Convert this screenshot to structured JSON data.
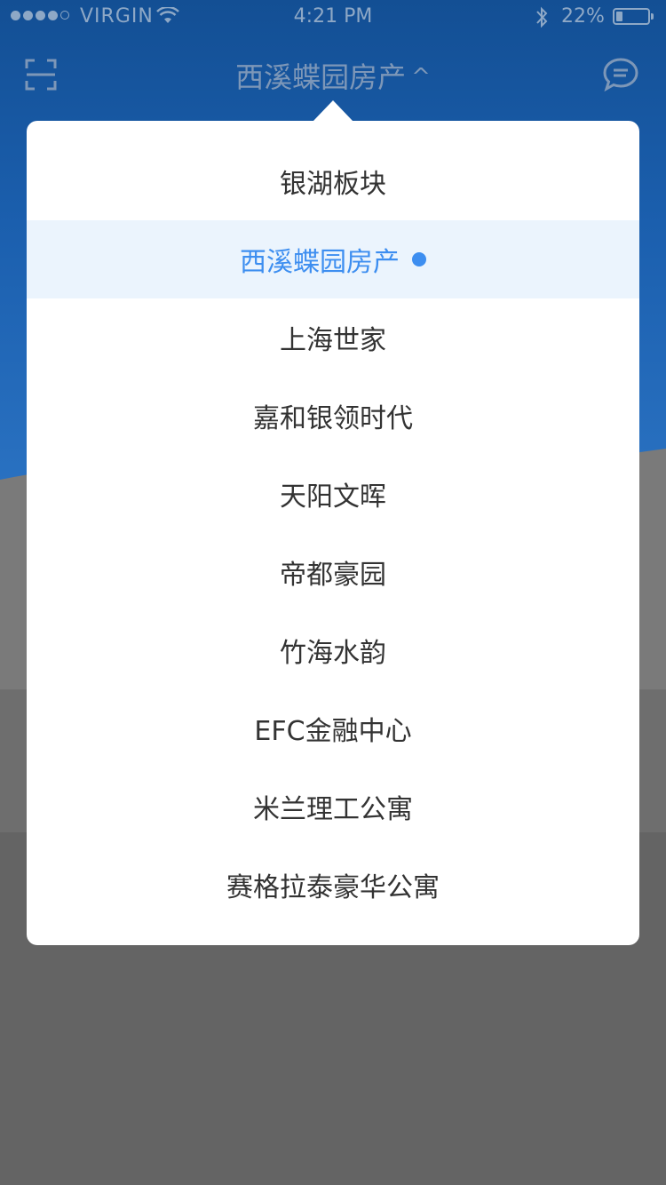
{
  "status_bar": {
    "carrier": "VIRGIN",
    "time": "4:21 PM",
    "battery_percent": "22%",
    "battery_level": 0.22,
    "signal_bars_filled": 4,
    "signal_bars_total": 5
  },
  "nav": {
    "title": "西溪蝶园房产",
    "chevron": "^",
    "left_icon": "scan-icon",
    "right_icon": "chat-icon"
  },
  "dropdown": {
    "selected_index": 1,
    "accent_color": "#3d8ef0",
    "selected_bg": "#ebf4fd",
    "items": [
      {
        "label": "银湖板块"
      },
      {
        "label": "西溪蝶园房产"
      },
      {
        "label": "上海世家"
      },
      {
        "label": "嘉和银领时代"
      },
      {
        "label": "天阳文晖"
      },
      {
        "label": "帝都豪园"
      },
      {
        "label": "竹海水韵"
      },
      {
        "label": "EFC金融中心"
      },
      {
        "label": "米兰理工公寓"
      },
      {
        "label": "赛格拉泰豪华公寓"
      }
    ]
  }
}
